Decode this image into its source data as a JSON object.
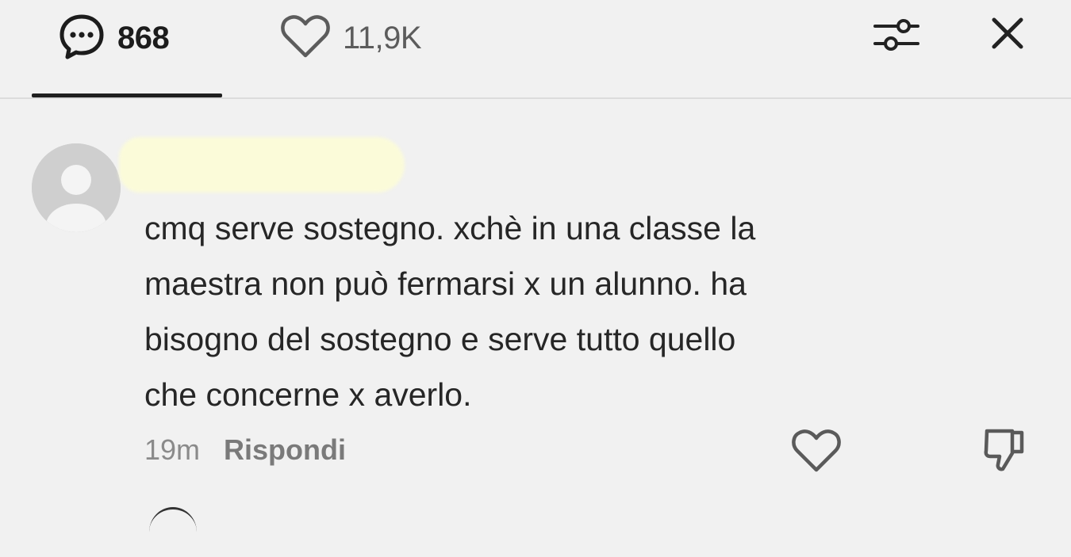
{
  "header": {
    "comments_tab": {
      "count": "868",
      "icon": "comment-bubble-icon"
    },
    "likes_tab": {
      "count": "11,9K",
      "icon": "heart-outline-icon"
    },
    "filter_icon": "sliders-icon",
    "close_icon": "close-icon"
  },
  "comment": {
    "avatar_icon": "default-avatar-icon",
    "text": "cmq serve sostegno. xchè in una classe la\nmaestra non può fermarsi x un alunno. ha\nbisogno del sostegno e serve tutto quello\nche concerne x averlo.",
    "timestamp": "19m",
    "reply_label": "Rispondi",
    "like_icon": "heart-outline-icon",
    "dislike_icon": "thumbs-down-icon"
  }
}
